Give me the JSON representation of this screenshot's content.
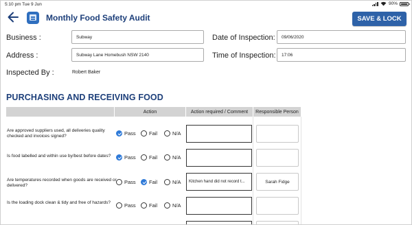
{
  "status_bar": {
    "time": "5:10 pm  Tue 9 Jun",
    "battery": "90%"
  },
  "header": {
    "title": "Monthly Food Safety Audit",
    "save_label": "SAVE & LOCK"
  },
  "form": {
    "business_label": "Business :",
    "business_value": "Subway",
    "address_label": "Address :",
    "address_value": "Subway Lane Homebush NSW 2140",
    "inspected_by_label": "Inspected By :",
    "inspected_by_value": "Robert Baker",
    "date_label": "Date of Inspection:",
    "date_value": "09/06/2020",
    "time_label": "Time of Inspection:",
    "time_value": "17:06"
  },
  "section": {
    "title": "PURCHASING AND RECEIVING FOOD",
    "columns": {
      "action": "Action",
      "comment": "Action required / Comment",
      "person": "Responsible Person"
    },
    "options": {
      "pass": "Pass",
      "fail": "Fail",
      "na": "N/A"
    },
    "rows": [
      {
        "question": "Are approved suppliers used, all deliveries quality checked and invoices signed?",
        "selected": "pass",
        "comment": "",
        "person": ""
      },
      {
        "question": "Is food labelled and within use by/best before dates?",
        "selected": "pass",
        "comment": "",
        "person": ""
      },
      {
        "question": "Are temperatures recorded when goods are received or delivered?",
        "selected": "fail",
        "comment": "Kitchen hand did not record t...",
        "person": "Sarah Fidge"
      },
      {
        "question": "Is the loading dock clean & tidy and free of hazards?",
        "selected": "none",
        "comment": "",
        "person": ""
      }
    ]
  }
}
